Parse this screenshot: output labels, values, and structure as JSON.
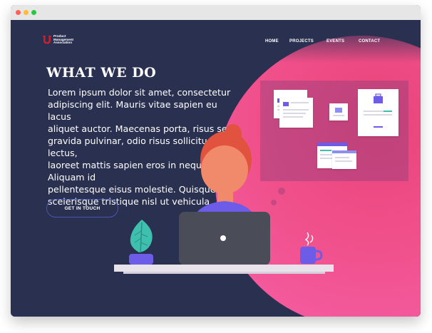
{
  "browser": {
    "controls": [
      "close",
      "minimize",
      "maximize"
    ]
  },
  "logo": {
    "lines": [
      "Product",
      "Management",
      "Association"
    ],
    "icon": "u-logo-icon"
  },
  "nav": {
    "items": [
      {
        "label": "HOME"
      },
      {
        "label": "PROJECTS"
      },
      {
        "label": "EVENTS"
      },
      {
        "label": "CONTACT"
      }
    ]
  },
  "hero": {
    "title": "WHAT WE DO",
    "body_lines": [
      "Lorem ipsum dolor sit amet, consectetur",
      "adipiscing elit. Mauris vitae sapien eu lacus",
      "aliquet auctor. Maecenas porta, risus sed",
      "gravida pulvinar, odio risus sollicitudin lectus,",
      "laoreet mattis sapien eros in neque. Aliquam id",
      "pellentesque eisus molestie. Quisque",
      "scelerisque tristique nisl ut vehicula"
    ],
    "cta_label": "GET IN TOUCH"
  },
  "colors": {
    "background": "#2a3050",
    "accent_pink": "#f0508a",
    "brand_red": "#cc1f2d",
    "purple": "#6c5ce7",
    "teal_leaf": "#3fbfae"
  },
  "illustration": {
    "icons": [
      "plant-icon",
      "laptop-icon",
      "mug-icon",
      "person-icon",
      "document-card-icon",
      "briefcase-icon"
    ]
  }
}
